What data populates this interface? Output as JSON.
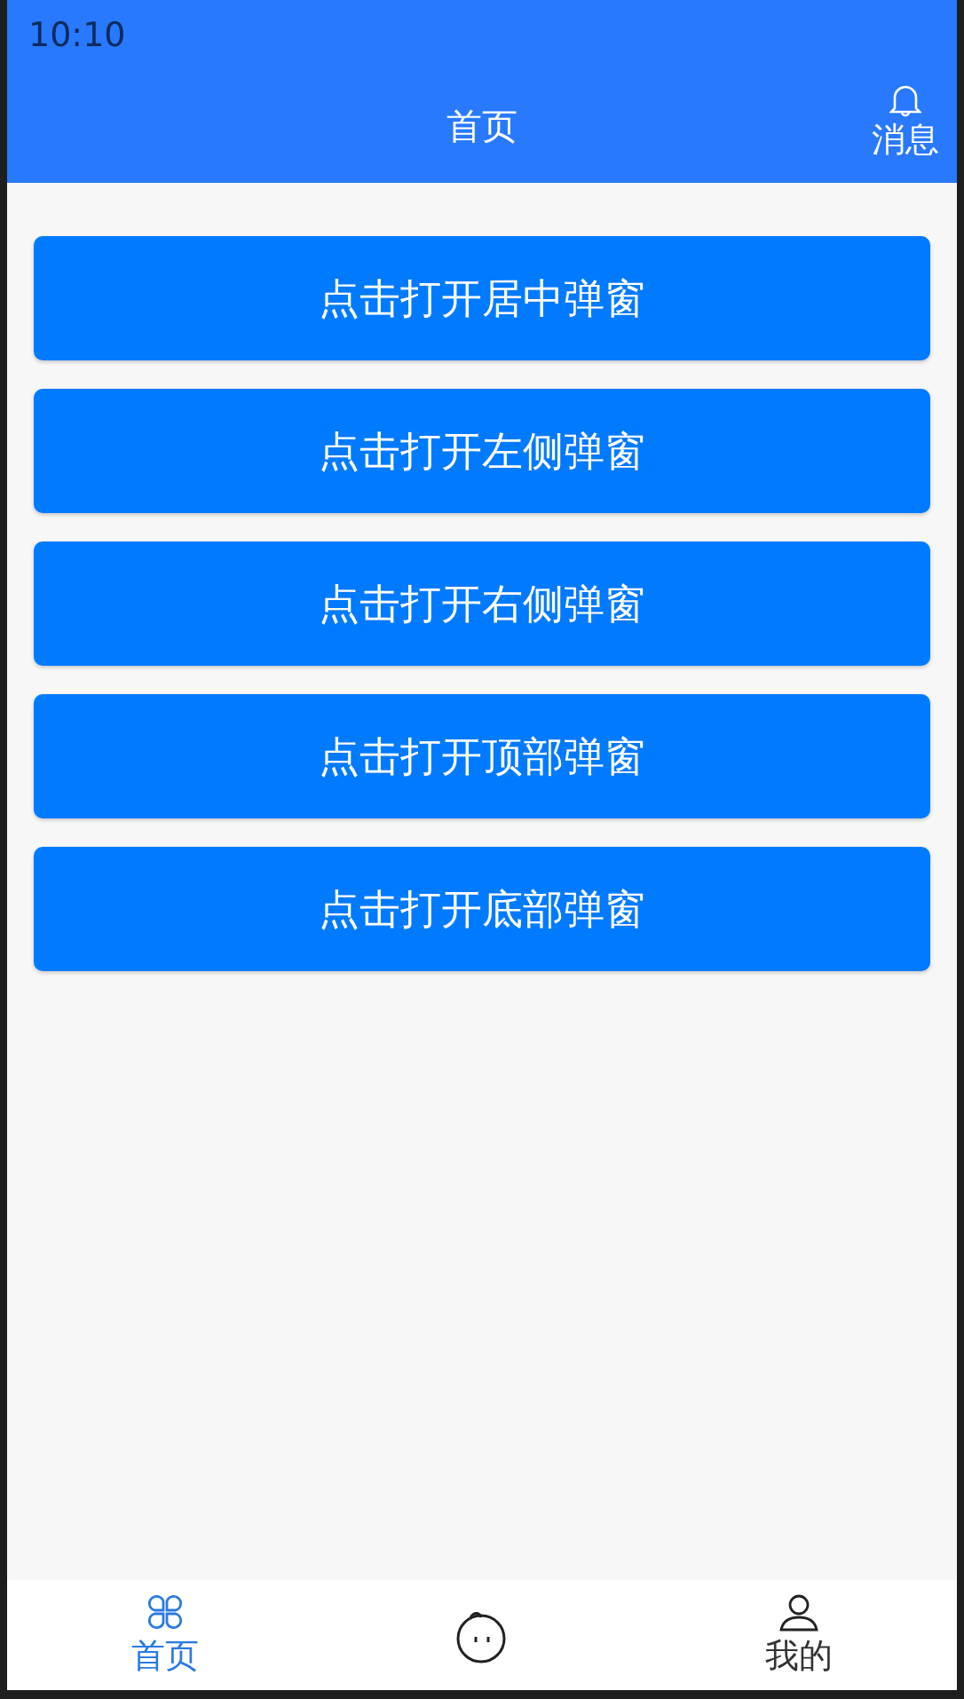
{
  "status_bar": {
    "time": "10:10"
  },
  "header": {
    "title": "首页",
    "action": {
      "label": "消息"
    }
  },
  "buttons": [
    "点击打开居中弹窗",
    "点击打开左侧弹窗",
    "点击打开右侧弹窗",
    "点击打开顶部弹窗",
    "点击打开底部弹窗"
  ],
  "tab_bar": [
    {
      "kind": "clover",
      "label": "首页",
      "selected": true
    },
    {
      "kind": "face",
      "selected": false
    },
    {
      "kind": "person",
      "label": "我的",
      "selected": false
    }
  ]
}
